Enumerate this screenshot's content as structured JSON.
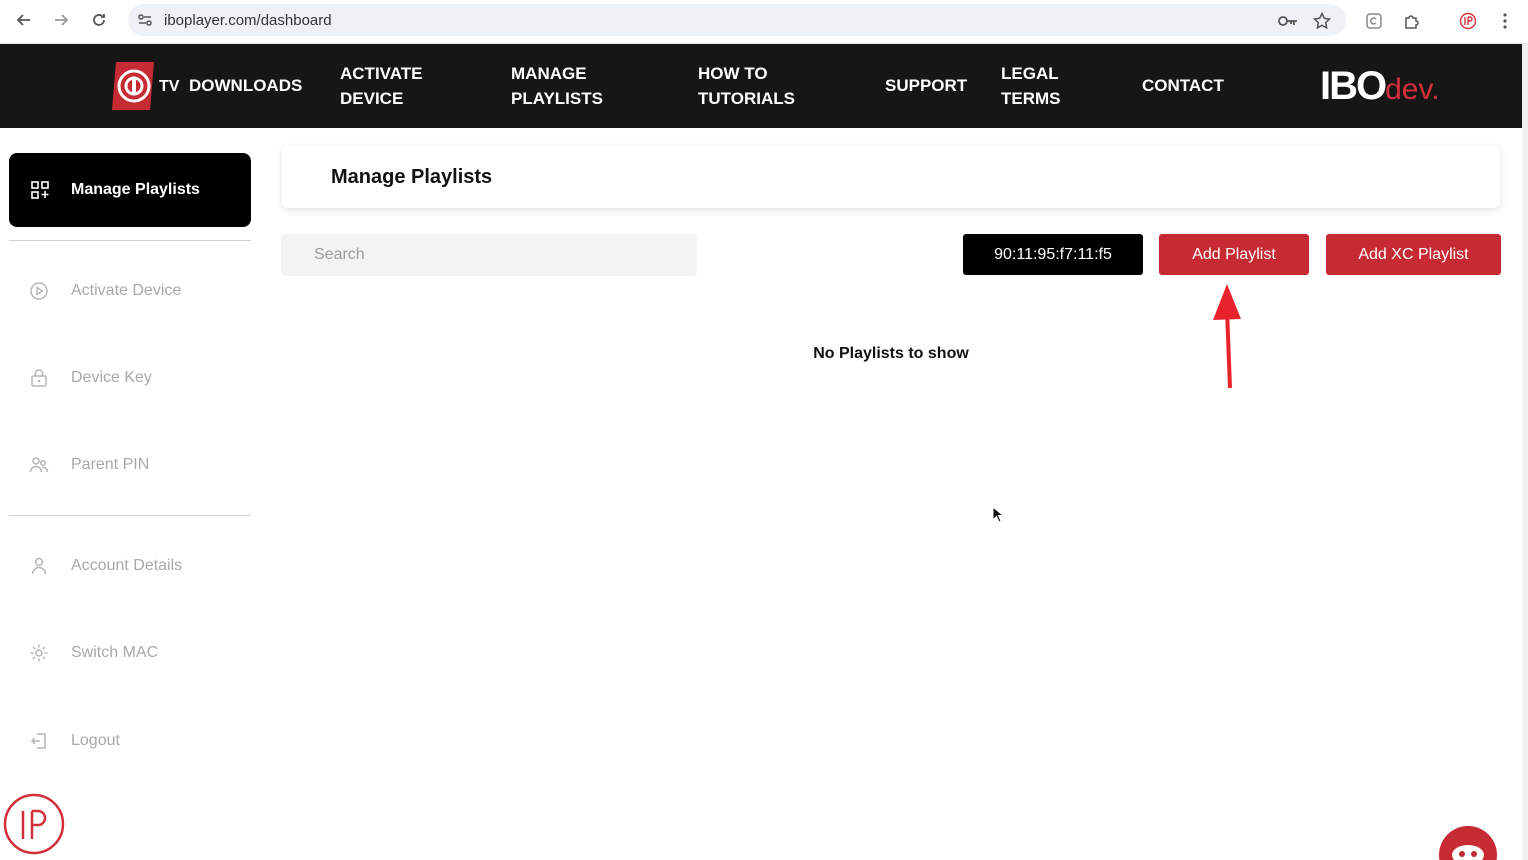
{
  "browser": {
    "url": "iboplayer.com/dashboard"
  },
  "header": {
    "logo_tv": "TV",
    "downloads": "DOWNLOADS",
    "nav": [
      {
        "line1": "ACTIVATE",
        "line2": "DEVICE"
      },
      {
        "line1": "MANAGE",
        "line2": "PLAYLISTS"
      },
      {
        "line1": "HOW TO",
        "line2": "TUTORIALS"
      },
      {
        "line1": "SUPPORT",
        "line2": ""
      },
      {
        "line1": "LEGAL",
        "line2": "TERMS"
      },
      {
        "line1": "CONTACT",
        "line2": ""
      }
    ],
    "brand_ibo": "IBO",
    "brand_dev": "dev."
  },
  "sidebar": {
    "active": {
      "label": "Manage Playlists",
      "icon": "grid-icon"
    },
    "items": [
      {
        "label": "Activate Device",
        "icon": "play-circle-icon"
      },
      {
        "label": "Device Key",
        "icon": "lock-icon"
      },
      {
        "label": "Parent PIN",
        "icon": "users-icon"
      },
      {
        "label": "Account Details",
        "icon": "user-icon"
      },
      {
        "label": "Switch MAC",
        "icon": "gear-icon"
      },
      {
        "label": "Logout",
        "icon": "logout-icon"
      }
    ]
  },
  "main": {
    "title": "Manage Playlists",
    "search_placeholder": "Search",
    "mac_address": "90:11:95:f7:11:f5",
    "add_playlist": "Add Playlist",
    "add_xc_playlist": "Add XC Playlist",
    "empty_message": "No Playlists to show"
  },
  "colors": {
    "accent_red": "#c62a33",
    "header_bg": "#161616",
    "annotation_arrow": "#e8232b"
  }
}
